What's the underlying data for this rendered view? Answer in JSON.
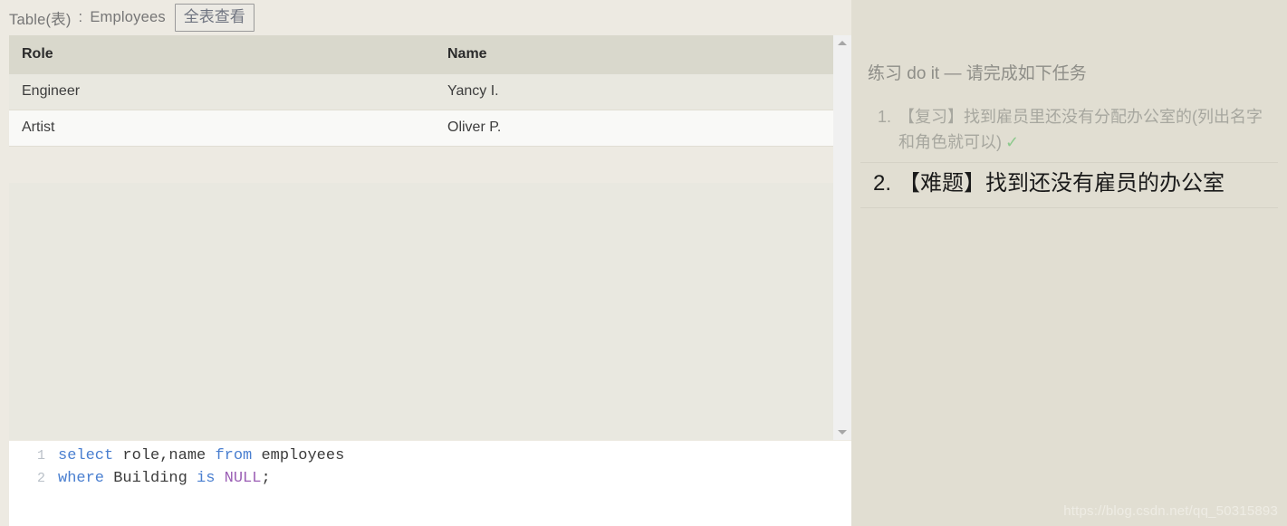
{
  "topbar": {
    "table_label": "Table(表)",
    "colon": ":",
    "table_name": "Employees",
    "view_all_button": "全表查看"
  },
  "table": {
    "columns": [
      "Role",
      "Name"
    ],
    "rows": [
      {
        "role": "Engineer",
        "name": "Yancy I."
      },
      {
        "role": "Artist",
        "name": "Oliver P."
      }
    ]
  },
  "scrollbar": {
    "up_icon": "triangle-up-icon",
    "down_icon": "triangle-down-icon"
  },
  "editor": {
    "lines": [
      {
        "number": "1",
        "tokens": [
          {
            "text": "select",
            "type": "keyword"
          },
          {
            "text": " role,name ",
            "type": "plain"
          },
          {
            "text": "from",
            "type": "keyword"
          },
          {
            "text": " employees",
            "type": "plain"
          }
        ]
      },
      {
        "number": "2",
        "tokens": [
          {
            "text": "where",
            "type": "keyword"
          },
          {
            "text": " Building ",
            "type": "plain"
          },
          {
            "text": "is",
            "type": "keyword"
          },
          {
            "text": " ",
            "type": "plain"
          },
          {
            "text": "NULL",
            "type": "null"
          },
          {
            "text": ";",
            "type": "plain"
          }
        ]
      }
    ]
  },
  "right_panel": {
    "title": "练习 do it — 请完成如下任务",
    "tasks": [
      {
        "number": "1.",
        "text": "【复习】找到雇员里还没有分配办公室的(列出名字和角色就可以)",
        "done": true,
        "check": "✓"
      },
      {
        "number": "2.",
        "text": "【难题】找到还没有雇员的办公室",
        "done": false,
        "check": ""
      }
    ]
  },
  "watermark": {
    "text": "https://blog.csdn.net/qq_50315893"
  },
  "colors": {
    "page_background": "#edeae2",
    "right_panel_background": "#e1ded2",
    "table_header": "#d9d8cc",
    "row_odd": "#e9e8e0",
    "row_even": "#f9f9f7",
    "editor_background": "#ffffff",
    "keyword": "#4a7fd0",
    "null_keyword": "#9b5fb5",
    "check_green": "#8cc98c",
    "scrollbar_track": "#f0f0f0"
  }
}
